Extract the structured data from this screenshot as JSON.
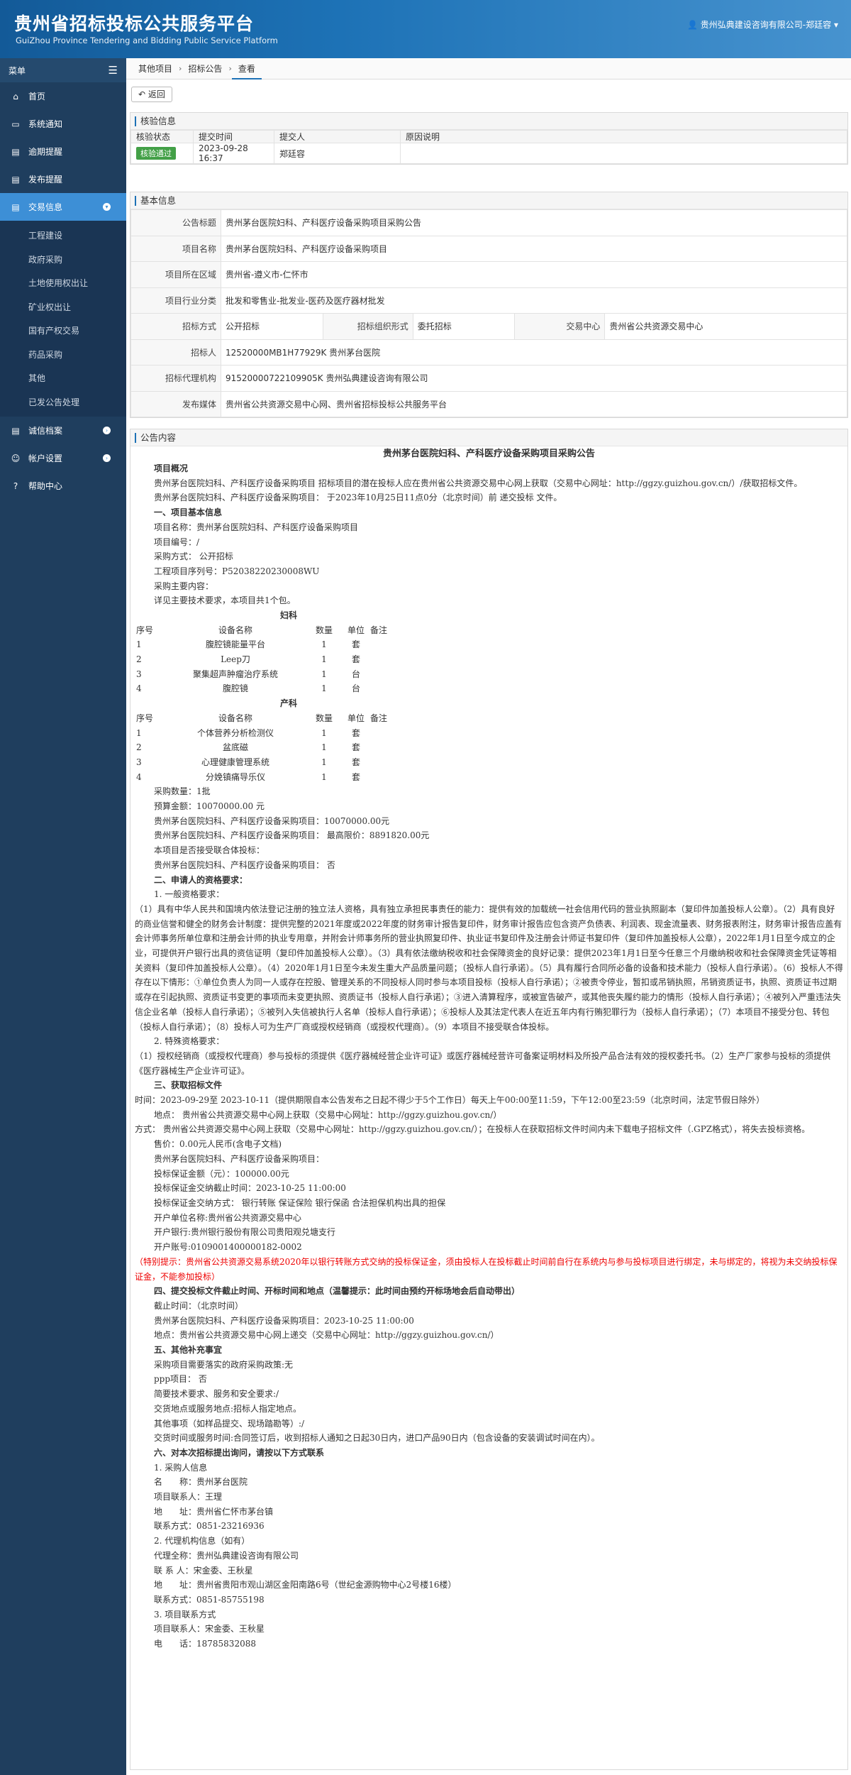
{
  "header": {
    "title": "贵州省招标投标公共服务平台",
    "subtitle": "GuiZhou Province Tendering and Bidding Public Service Platform",
    "user": "贵州弘典建设咨询有限公司-郑廷容"
  },
  "sidebar": {
    "menu_label": "菜单",
    "items": [
      {
        "icon": "home-icon",
        "label": "首页"
      },
      {
        "icon": "monitor-icon",
        "label": "系统通知"
      },
      {
        "icon": "inbox-icon",
        "label": "逾期提醒"
      },
      {
        "icon": "inbox-icon",
        "label": "发布提醒"
      },
      {
        "icon": "inbox-icon",
        "label": "交易信息"
      }
    ],
    "sub_items": [
      "工程建设",
      "政府采购",
      "土地使用权出让",
      "矿业权出让",
      "国有产权交易",
      "药品采购",
      "其他",
      "已发公告处理"
    ],
    "bottom_items": [
      {
        "icon": "inbox-icon",
        "label": "诚信档案"
      },
      {
        "icon": "user-icon",
        "label": "帐户设置"
      },
      {
        "icon": "help-icon",
        "label": "帮助中心"
      }
    ]
  },
  "breadcrumb": [
    "其他项目",
    "招标公告",
    "查看"
  ],
  "back_label": "返回",
  "review": {
    "title": "核验信息",
    "headers": [
      "核验状态",
      "提交时间",
      "提交人",
      "原因说明"
    ],
    "status": "核验通过",
    "time": "2023-09-28 16:37",
    "submitter": "郑廷容",
    "reason": ""
  },
  "basic": {
    "title": "基本信息",
    "rows": [
      {
        "label": "公告标题",
        "value": "贵州茅台医院妇科、产科医疗设备采购项目采购公告"
      },
      {
        "label": "项目名称",
        "value": "贵州茅台医院妇科、产科医疗设备采购项目"
      },
      {
        "label": "项目所在区域",
        "value": "贵州省-遵义市-仁怀市"
      },
      {
        "label": "项目行业分类",
        "value": "批发和零售业-批发业-医药及医疗器材批发"
      }
    ],
    "method_label": "招标方式",
    "method": "公开招标",
    "org_label": "招标组织形式",
    "org": "委托招标",
    "center_label": "交易中心",
    "center": "贵州省公共资源交易中心",
    "rows2": [
      {
        "label": "招标人",
        "value": "12520000MB1H77929K 贵州茅台医院"
      },
      {
        "label": "招标代理机构",
        "value": "91520000722109905K 贵州弘典建设咨询有限公司"
      },
      {
        "label": "发布媒体",
        "value": "贵州省公共资源交易中心网、贵州省招标投标公共服务平台"
      }
    ]
  },
  "announcement": {
    "title": "公告内容",
    "heading": "贵州茅台医院妇科、产科医疗设备采购项目采购公告",
    "lines_a": [
      {
        "t": "项目概况",
        "c": "ind bold"
      },
      {
        "t": "贵州茅台医院妇科、产科医疗设备采购项目 招标项目的潜在投标人应在贵州省公共资源交易中心网上获取（交易中心网址：http://ggzy.guizhou.gov.cn/）/获取招标文件。",
        "c": "ind"
      },
      {
        "t": "贵州茅台医院妇科、产科医疗设备采购项目： 于2023年10月25日11点0分（北京时间）前 递交投标 文件。",
        "c": "ind"
      },
      {
        "t": "一、项目基本信息",
        "c": "ind bold"
      },
      {
        "t": "项目名称：贵州茅台医院妇科、产科医疗设备采购项目",
        "c": "ind"
      },
      {
        "t": "项目编号：/",
        "c": "ind"
      },
      {
        "t": "采购方式： 公开招标",
        "c": "ind"
      },
      {
        "t": "工程项目序列号：P52038220230008WU",
        "c": "ind"
      },
      {
        "t": "采购主要内容：",
        "c": "ind"
      },
      {
        "t": "详见主要技术要求，本项目共1个包。",
        "c": "ind"
      }
    ],
    "table1_title": "妇科",
    "table_headers": [
      "序号",
      "设备名称",
      "数量",
      "单位",
      "备注"
    ],
    "table1": [
      [
        "1",
        "腹腔镜能量平台",
        "1",
        "套",
        ""
      ],
      [
        "2",
        "Leep刀",
        "1",
        "套",
        ""
      ],
      [
        "3",
        "聚集超声肿瘤治疗系统",
        "1",
        "台",
        ""
      ],
      [
        "4",
        "腹腔镜",
        "1",
        "台",
        ""
      ]
    ],
    "table2_title": "产科",
    "table2": [
      [
        "1",
        "个体营养分析检测仪",
        "1",
        "套",
        ""
      ],
      [
        "2",
        "盆底磁",
        "1",
        "套",
        ""
      ],
      [
        "3",
        "心理健康管理系统",
        "1",
        "套",
        ""
      ],
      [
        "4",
        "分娩镇痛导乐仪",
        "1",
        "套",
        ""
      ]
    ],
    "lines_b": [
      {
        "t": "采购数量：1批",
        "c": "ind"
      },
      {
        "t": "预算金额：10070000.00 元",
        "c": "ind"
      },
      {
        "t": "贵州茅台医院妇科、产科医疗设备采购项目：10070000.00元",
        "c": "ind"
      },
      {
        "t": "贵州茅台医院妇科、产科医疗设备采购项目： 最高限价：8891820.00元",
        "c": "ind"
      },
      {
        "t": "本项目是否接受联合体投标：",
        "c": "ind"
      },
      {
        "t": "贵州茅台医院妇科、产科医疗设备采购项目： 否",
        "c": "ind"
      },
      {
        "t": "二、申请人的资格要求：",
        "c": "ind bold"
      },
      {
        "t": "1. 一般资格要求：",
        "c": "ind"
      },
      {
        "t": "（1）具有中华人民共和国境内依法登记注册的独立法人资格，具有独立承担民事责任的能力：提供有效的加载统一社会信用代码的营业执照副本（复印件加盖投标人公章）。（2）具有良好的商业信誉和健全的财务会计制度：提供完整的2021年度或2022年度的财务审计报告复印件，财务审计报告应包含资产负债表、利润表、现金流量表、财务报表附注，财务审计报告应盖有会计师事务所单位章和注册会计师的执业专用章，并附会计师事务所的营业执照复印件、执业证书复印件及注册会计师证书复印件（复印件加盖投标人公章），2022年1月1日至今成立的企业，可提供开户银行出具的资信证明（复印件加盖投标人公章）。（3）具有依法缴纳税收和社会保障资金的良好记录：提供2023年1月1日至今任意三个月缴纳税收和社会保障资金凭证等相关资料（复印件加盖投标人公章）。（4）2020年1月1日至今未发生重大产品质量问题；（投标人自行承诺）。（5）具有履行合同所必备的设备和技术能力（投标人自行承诺）。（6）投标人不得存在以下情形：①单位负责人为同一人或存在控股、管理关系的不同投标人同时参与本项目投标（投标人自行承诺）；②被责令停业，暂扣或吊销执照，吊销资质证书，执照、资质证书过期或存在引起执照、资质证书变更的事项而未变更执照、资质证书（投标人自行承诺）；③进入清算程序，或被宣告破产，或其他丧失履约能力的情形（投标人自行承诺）；④被列入严重违法失信企业名单（投标人自行承诺）；⑤被列入失信被执行人名单（投标人自行承诺）；⑥投标人及其法定代表人在近五年内有行贿犯罪行为（投标人自行承诺）；（7）本项目不接受分包、转包（投标人自行承诺）；（8）投标人可为生产厂商或授权经销商（或授权代理商）。（9）本项目不接受联合体投标。",
        "c": ""
      },
      {
        "t": "2. 特殊资格要求：",
        "c": "ind"
      },
      {
        "t": "（1）授权经销商（或授权代理商）参与投标的须提供《医疗器械经营企业许可证》或医疗器械经营许可备案证明材料及所投产品合法有效的授权委托书。（2）生产厂家参与投标的须提供《医疗器械生产企业许可证》。",
        "c": ""
      },
      {
        "t": "三、获取招标文件",
        "c": "ind bold"
      },
      {
        "t": "时间：2023-09-29至 2023-10-11（提供期限自本公告发布之日起不得少于5个工作日）每天上午00:00至11:59，下午12:00至23:59（北京时间，法定节假日除外）",
        "c": ""
      },
      {
        "t": "地点： 贵州省公共资源交易中心网上获取（交易中心网址：http://ggzy.guizhou.gov.cn/）",
        "c": "ind"
      },
      {
        "t": "方式： 贵州省公共资源交易中心网上获取（交易中心网址：http://ggzy.guizhou.gov.cn/）；在投标人在获取招标文件时间内未下载电子招标文件（.GPZ格式），将失去投标资格。",
        "c": ""
      },
      {
        "t": "售价：0.00元人民币(含电子文档)",
        "c": "ind"
      },
      {
        "t": "贵州茅台医院妇科、产科医疗设备采购项目：",
        "c": "ind"
      },
      {
        "t": "投标保证金额（元）：100000.00元",
        "c": "ind"
      },
      {
        "t": "投标保证金交纳截止时间：2023-10-25 11:00:00",
        "c": "ind"
      },
      {
        "t": "投标保证金交纳方式： 银行转账 保证保险 银行保函 合法担保机构出具的担保",
        "c": "ind"
      },
      {
        "t": "开户单位名称:贵州省公共资源交易中心",
        "c": "ind"
      },
      {
        "t": "开户银行:贵州银行股份有限公司贵阳观兑塘支行",
        "c": "ind"
      },
      {
        "t": "开户账号:0109001400000182-0002",
        "c": "ind"
      },
      {
        "t": "（特别提示：贵州省公共资源交易系统2020年以银行转账方式交纳的投标保证金，须由投标人在投标截止时间前自行在系统内与参与投标项目进行绑定，未与绑定的，将视为未交纳投标保证金，不能参加投标）",
        "c": "red"
      },
      {
        "t": "四、提交投标文件截止时间、开标时间和地点（温馨提示：此时间由预约开标场地会后自动带出）",
        "c": "ind bold"
      },
      {
        "t": "截止时间：（北京时间）",
        "c": "ind"
      },
      {
        "t": "贵州茅台医院妇科、产科医疗设备采购项目：2023-10-25 11:00:00",
        "c": "ind"
      },
      {
        "t": "地点：贵州省公共资源交易中心网上递交（交易中心网址：http://ggzy.guizhou.gov.cn/）",
        "c": "ind"
      },
      {
        "t": "五、其他补充事宜",
        "c": "ind bold"
      },
      {
        "t": "采购项目需要落实的政府采购政策:无",
        "c": "ind"
      },
      {
        "t": "ppp项目： 否",
        "c": "ind"
      },
      {
        "t": "简要技术要求、服务和安全要求:/",
        "c": "ind"
      },
      {
        "t": "交货地点或服务地点:招标人指定地点。",
        "c": "ind"
      },
      {
        "t": "其他事项（如样品提交、现场踏勘等）:/",
        "c": "ind"
      },
      {
        "t": "交货时间或服务时间:合同签订后，收到招标人通知之日起30日内，进口产品90日内（包含设备的安装调试时间在内）。",
        "c": "ind"
      },
      {
        "t": "六、对本次招标提出询问，请按以下方式联系",
        "c": "ind bold"
      },
      {
        "t": "1. 采购人信息",
        "c": "ind"
      },
      {
        "t": "名　　称：贵州茅台医院",
        "c": "ind"
      },
      {
        "t": "项目联系人：王理",
        "c": "ind"
      },
      {
        "t": "地　　址：贵州省仁怀市茅台镇",
        "c": "ind"
      },
      {
        "t": "联系方式：0851-23216936",
        "c": "ind"
      },
      {
        "t": "2. 代理机构信息（如有）",
        "c": "ind"
      },
      {
        "t": "代理全称：贵州弘典建设咨询有限公司",
        "c": "ind"
      },
      {
        "t": "联 系 人：宋金委、王秋星",
        "c": "ind"
      },
      {
        "t": "地　　址：贵州省贵阳市观山湖区金阳南路6号（世纪金源购物中心2号楼16楼）",
        "c": "ind"
      },
      {
        "t": "联系方式：0851-85755198",
        "c": "ind"
      },
      {
        "t": "3. 项目联系方式",
        "c": "ind"
      },
      {
        "t": "项目联系人：宋金委、王秋星",
        "c": "ind"
      },
      {
        "t": "电　　话：18785832088",
        "c": "ind"
      }
    ]
  }
}
